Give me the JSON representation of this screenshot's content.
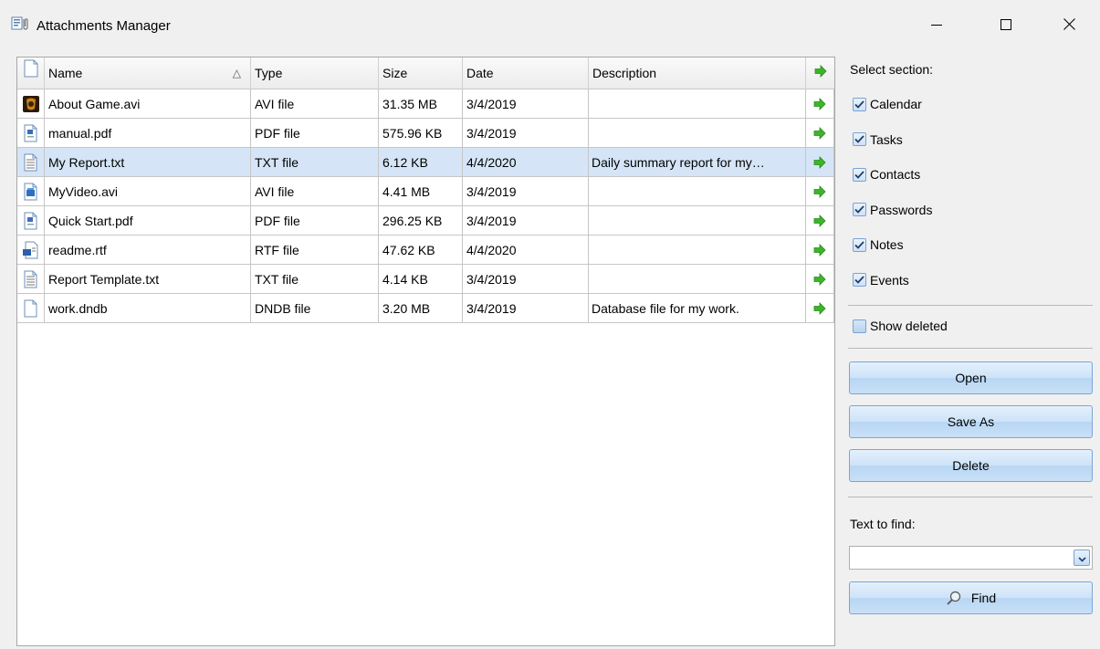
{
  "window": {
    "title": "Attachments Manager",
    "app_icon": "attachment-file-icon",
    "controls": [
      "minimize-icon",
      "maximize-icon",
      "close-icon"
    ]
  },
  "grid": {
    "columns": {
      "name": "Name",
      "type": "Type",
      "size": "Size",
      "date": "Date",
      "description": "Description"
    },
    "sort_indicator": "△",
    "rows": [
      {
        "name": "About Game.avi",
        "type": "AVI file",
        "size": "31.35 MB",
        "date": "3/4/2019",
        "description": "",
        "icon": "game-video-icon"
      },
      {
        "name": "manual.pdf",
        "type": "PDF file",
        "size": "575.96 KB",
        "date": "3/4/2019",
        "description": "",
        "icon": "pdf-file-icon"
      },
      {
        "name": "My Report.txt",
        "type": "TXT file",
        "size": "6.12 KB",
        "date": "4/4/2020",
        "description": "Daily summary report for my…",
        "icon": "text-file-icon"
      },
      {
        "name": "MyVideo.avi",
        "type": "AVI file",
        "size": "4.41 MB",
        "date": "3/4/2019",
        "description": "",
        "icon": "video-file-icon"
      },
      {
        "name": "Quick Start.pdf",
        "type": "PDF file",
        "size": "296.25 KB",
        "date": "3/4/2019",
        "description": "",
        "icon": "pdf-file-icon"
      },
      {
        "name": "readme.rtf",
        "type": "RTF file",
        "size": "47.62 KB",
        "date": "4/4/2020",
        "description": "",
        "icon": "rtf-file-icon"
      },
      {
        "name": "Report Template.txt",
        "type": "TXT file",
        "size": "4.14 KB",
        "date": "3/4/2019",
        "description": "",
        "icon": "text-file-icon"
      },
      {
        "name": "work.dndb",
        "type": "DNDB file",
        "size": "3.20 MB",
        "date": "3/4/2019",
        "description": "Database file for my work.",
        "icon": "blank-file-icon"
      }
    ],
    "selected_row": 2
  },
  "panel": {
    "select_section_label": "Select section:",
    "sections": [
      {
        "label": "Calendar",
        "checked": true
      },
      {
        "label": "Tasks",
        "checked": true
      },
      {
        "label": "Contacts",
        "checked": true
      },
      {
        "label": "Passwords",
        "checked": true
      },
      {
        "label": "Notes",
        "checked": true
      },
      {
        "label": "Events",
        "checked": true
      }
    ],
    "show_deleted": {
      "label": "Show deleted",
      "checked": false
    },
    "open_label": "Open",
    "save_as_label": "Save As",
    "delete_label": "Delete",
    "text_to_find_label": "Text to find:",
    "search_value": "",
    "find_label": "Find"
  },
  "colors": {
    "selected_row": "#d5e5f7",
    "arrow_green": "#3cb52a",
    "button_border": "#78a6d6"
  }
}
